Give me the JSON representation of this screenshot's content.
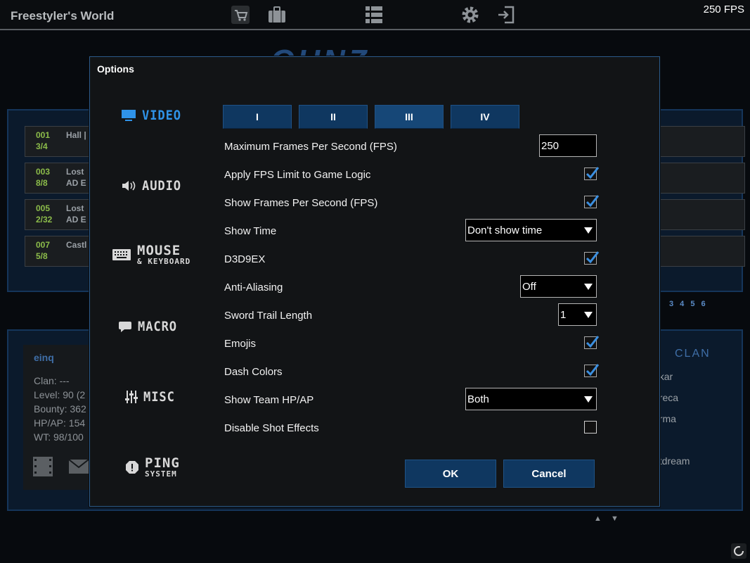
{
  "topbar": {
    "title": "Freestyler's World",
    "fps": "250 FPS",
    "icons": [
      "shop-icon",
      "inventory-icon",
      "menu-list-icon",
      "settings-icon",
      "exit-icon"
    ]
  },
  "background": {
    "rooms": [
      {
        "num": "001",
        "count": "3/4",
        "name": "Hall |"
      },
      {
        "num": "003",
        "count": "8/8",
        "name": "Lost",
        "line2": "AD E"
      },
      {
        "num": "005",
        "count": "2/32",
        "name": "Lost",
        "line2": "AD E"
      },
      {
        "num": "007",
        "count": "5/8",
        "name": "Castl"
      }
    ],
    "pages": "3 4 5 6",
    "player": {
      "name": "einq",
      "stats": [
        "Clan: ---",
        "Level: 90 (2",
        "Bounty: 362",
        "HP/AP: 154",
        "WT: 98/100"
      ]
    },
    "clan_header": "CLAN",
    "clan_members": [
      "rikar",
      "ureca",
      "arma",
      "etdream"
    ]
  },
  "dialog": {
    "title": "Options",
    "categories": [
      {
        "label": "VIDEO",
        "icon": "monitor-icon"
      },
      {
        "label": "AUDIO",
        "icon": "speaker-icon"
      },
      {
        "label": "MOUSE",
        "sub": "& KEYBOARD",
        "icon": "keyboard-icon"
      },
      {
        "label": "MACRO",
        "icon": "chat-bubble-icon"
      },
      {
        "label": "MISC",
        "icon": "sliders-icon"
      },
      {
        "label": "PING",
        "sub": "SYSTEM",
        "icon": "alert-icon"
      }
    ],
    "tabs": [
      "I",
      "II",
      "III",
      "IV"
    ],
    "options": {
      "max_fps": {
        "label": "Maximum Frames Per Second (FPS)",
        "value": "250"
      },
      "fps_limit": {
        "label": "Apply FPS Limit to Game Logic",
        "checked": true
      },
      "show_fps": {
        "label": "Show Frames Per Second (FPS)",
        "checked": true
      },
      "show_time": {
        "label": "Show Time",
        "value": "Don't show time"
      },
      "d3d9ex": {
        "label": "D3D9EX",
        "checked": true
      },
      "anti_aliasing": {
        "label": "Anti-Aliasing",
        "value": "Off"
      },
      "sword_trail": {
        "label": "Sword Trail Length",
        "value": "1"
      },
      "emojis": {
        "label": "Emojis",
        "checked": true
      },
      "dash_colors": {
        "label": "Dash Colors",
        "checked": true
      },
      "team_hp": {
        "label": "Show Team HP/AP",
        "value": "Both"
      },
      "disable_shot": {
        "label": "Disable Shot Effects",
        "checked": false
      }
    },
    "buttons": {
      "ok": "OK",
      "cancel": "Cancel"
    }
  },
  "colors": {
    "accent": "#2f93e8",
    "button": "#0f3760",
    "dialog_bg": "#121416",
    "check": "#3b8fe0"
  }
}
